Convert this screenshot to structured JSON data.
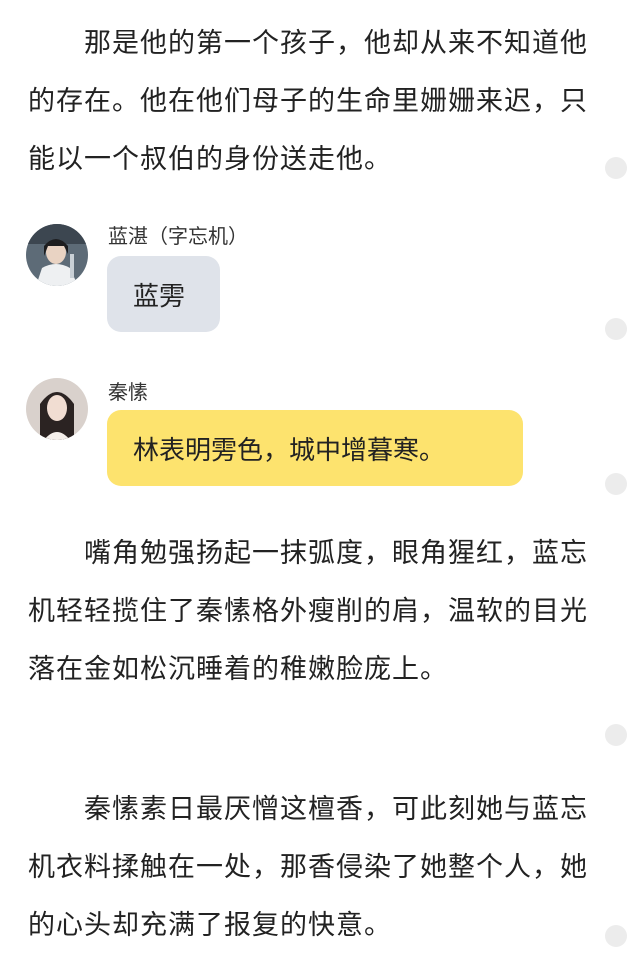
{
  "paragraphs": {
    "p1": "那是他的第一个孩子，他却从来不知道他的存在。他在他们母子的生命里姗姗来迟，只能以一个叔伯的身份送走他。",
    "p2": "嘴角勉强扬起一抹弧度，眼角猩红，蓝忘机轻轻揽住了秦愫格外瘦削的肩，温软的目光落在金如松沉睡着的稚嫩脸庞上。",
    "p3": "秦愫素日最厌憎这檀香，可此刻她与蓝忘机衣料揉触在一处，那香侵染了她整个人，她的心头却充满了报复的快意。"
  },
  "chat": [
    {
      "name": "蓝湛（字忘机）",
      "message": "蓝雱",
      "bubble_color": "#dfe3ea",
      "avatar": "avatar-man-white-robes"
    },
    {
      "name": "秦愫",
      "message": "林表明雱色，城中增暮寒。",
      "bubble_color": "#fde36e",
      "avatar": "avatar-woman"
    }
  ],
  "scroll_markers": [
    "dot-icon",
    "dot-icon",
    "dot-icon",
    "dot-icon",
    "dot-icon"
  ]
}
